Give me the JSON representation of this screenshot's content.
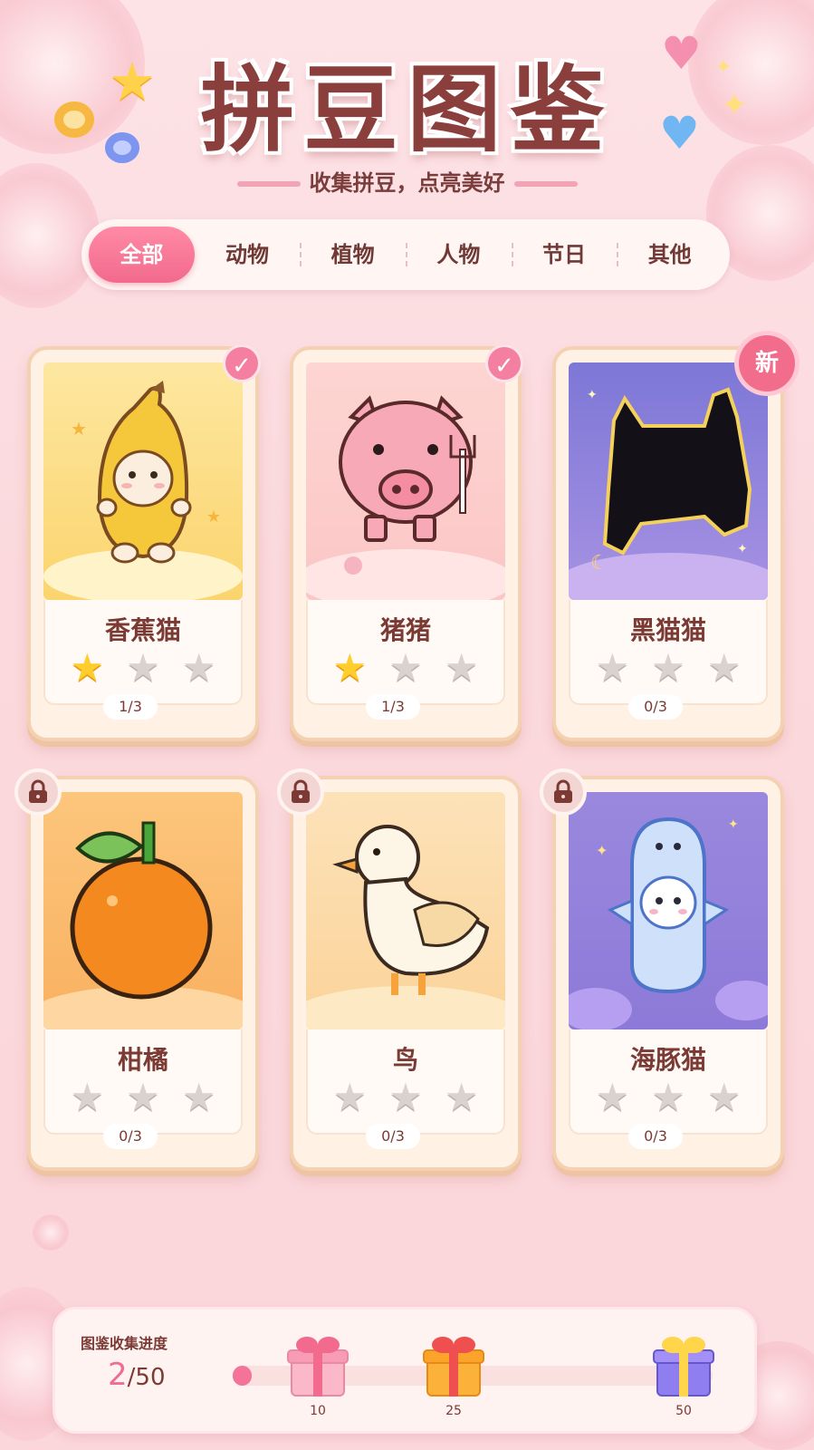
{
  "header": {
    "title": "拼豆图鉴",
    "subtitle": "收集拼豆，点亮美好"
  },
  "tabs": [
    {
      "label": "全部",
      "active": true
    },
    {
      "label": "动物",
      "active": false
    },
    {
      "label": "植物",
      "active": false
    },
    {
      "label": "人物",
      "active": false
    },
    {
      "label": "节日",
      "active": false
    },
    {
      "label": "其他",
      "active": false
    }
  ],
  "cards": [
    {
      "name": "香蕉猫",
      "stars_lit": 1,
      "stars_total": 3,
      "count": "1/3",
      "status": "completed",
      "art_theme": "banana-cat"
    },
    {
      "name": "猪猪",
      "stars_lit": 1,
      "stars_total": 3,
      "count": "1/3",
      "status": "completed",
      "art_theme": "pig"
    },
    {
      "name": "黑猫猫",
      "stars_lit": 0,
      "stars_total": 3,
      "count": "0/3",
      "status": "new",
      "badge": "新",
      "art_theme": "black-cat"
    },
    {
      "name": "柑橘",
      "stars_lit": 0,
      "stars_total": 3,
      "count": "0/3",
      "status": "locked",
      "art_theme": "orange"
    },
    {
      "name": "鸟",
      "stars_lit": 0,
      "stars_total": 3,
      "count": "0/3",
      "status": "locked",
      "art_theme": "duck"
    },
    {
      "name": "海豚猫",
      "stars_lit": 0,
      "stars_total": 3,
      "count": "0/3",
      "status": "locked",
      "art_theme": "dolphin-cat"
    }
  ],
  "progress": {
    "label": "图鉴收集进度",
    "current": "2",
    "total": "/50",
    "current_value": 2,
    "max_value": 50,
    "milestones": [
      {
        "value": "10",
        "color": "pink"
      },
      {
        "value": "25",
        "color": "orange"
      },
      {
        "value": "50",
        "color": "purple"
      }
    ]
  },
  "colors": {
    "accent": "#f26a8d",
    "title": "#8b3f3c",
    "star_lit": "#ffcd2c",
    "star_empty": "#d9d2d0"
  }
}
